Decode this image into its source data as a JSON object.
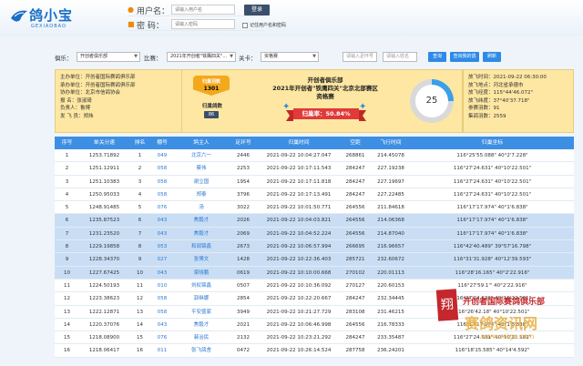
{
  "brand": {
    "name": "鸽小宝",
    "subtitle": "GEXIAOBAO"
  },
  "login": {
    "username_label": "用户名：",
    "username_placeholder": "请输入用户名",
    "password_label": "密  码：",
    "password_placeholder": "请输入密码",
    "login_button": "登录",
    "remember_label": "记住用户名和密码"
  },
  "filters": {
    "club_label": "俱乐：",
    "club_value": "开创者俱乐部",
    "race_label": "比赛：",
    "race_value": "2021年开创者\"铁鹰四关\"...",
    "level_label": "关卡：",
    "level_value": "资格赛",
    "ring_placeholder": "请输入足环号",
    "name_placeholder": "请输入姓名",
    "search_button": "查询",
    "my_pigeon_button": "查询我的鸽",
    "refresh_button": "刷新"
  },
  "club_info": [
    "主办单位：开创者国际赛鸽俱乐部",
    "承办单位：开创者国际赛鸽俱乐部",
    "协办单位：北京市信鸽协会",
    "报  名：张淑琦",
    "负责人：鲁博",
    "发 飞 员：郑炜"
  ],
  "stats": {
    "returned_label": "归巢羽数",
    "returned_value": "1301",
    "feathers_label": "归巢鸽数",
    "feathers_value": "86"
  },
  "race": {
    "club": "开创者俱乐部",
    "title": "2021年开创者\"铁鹰四关\"北京北部赛区",
    "stage": "资格赛",
    "rate_label": "归巢率：",
    "rate_value": "50.84%"
  },
  "gauge": {
    "value": "25",
    "fraction": 0.25
  },
  "release_info": [
    "放飞时间：2021-09-22 06:30:00",
    "放飞地点：河北省承德市",
    "放飞经度：115°44'46.072\"",
    "放飞纬度：37°40'37.718\"",
    "参赛羽数：91",
    "集鸽羽数：2559"
  ],
  "table": {
    "headers": [
      "序号",
      "单关分速",
      "排名",
      "棚号",
      "鸽主人",
      "足环号",
      "归巢时间",
      "空距",
      "飞行时间",
      "归巢坐标"
    ],
    "rows": [
      [
        "1",
        "1253.71892",
        "1",
        "049",
        "北京六一",
        "2446",
        "2021-09-22 10:04:27.047",
        "268861",
        "214.45078",
        "116°25'55.088\" 40°2'7.228\""
      ],
      [
        "2",
        "1251.12911",
        "2",
        "058",
        "蔡伟",
        "2253",
        "2021-09-22 10:17:11.543",
        "284247",
        "227.19238",
        "116°27'24.631\" 40°10'22.501\""
      ],
      [
        "3",
        "1251.10383",
        "3",
        "058",
        "谢立国",
        "1954",
        "2021-09-22 10:17:11.818",
        "284247",
        "227.19697",
        "116°27'24.631\" 40°10'22.501\""
      ],
      [
        "4",
        "1250.95033",
        "4",
        "058",
        "郑泰",
        "3796",
        "2021-09-22 10:17:13.491",
        "284247",
        "227.22485",
        "116°27'24.631\" 40°10'22.501\""
      ],
      [
        "5",
        "1248.91485",
        "5",
        "076",
        "汤",
        "3022",
        "2021-09-22 10:01:50.771",
        "264556",
        "211.84618",
        "116°17'17.974\" 40°1'6.838\""
      ],
      [
        "6",
        "1235.87523",
        "6",
        "043",
        "焦毅才",
        "2026",
        "2021-09-22 10:04:03.821",
        "264556",
        "214.06368",
        "116°17'17.974\" 40°1'6.838\""
      ],
      [
        "7",
        "1231.23520",
        "7",
        "043",
        "焦毅才",
        "2069",
        "2021-09-22 10:04:52.224",
        "264556",
        "214.87040",
        "116°17'17.974\" 40°1'6.838\""
      ],
      [
        "8",
        "1229.19858",
        "8",
        "053",
        "和闻锦鑫",
        "2673",
        "2021-09-22 10:06:57.994",
        "266695",
        "216.96657",
        "116°42'40.489\" 39°57'16.798\""
      ],
      [
        "9",
        "1228.34370",
        "9",
        "027",
        "张博文",
        "1428",
        "2021-09-22 10:22:36.403",
        "285721",
        "232.60672",
        "116°31'31.928\" 40°12'39.593\""
      ],
      [
        "10",
        "1227.67425",
        "10",
        "043",
        "梁晓鹏",
        "0619",
        "2021-09-22 10:10:00.668",
        "270102",
        "220.01113",
        "116°28'16.165\" 40°2'22.916\""
      ],
      [
        "11",
        "1224.50193",
        "11",
        "010",
        "刘权锦鑫",
        "0507",
        "2021-09-22 10:10:36.092",
        "270127",
        "220.60153",
        "116°27'59.1'\" 40°2'22.916\""
      ],
      [
        "12",
        "1223.38623",
        "12",
        "058",
        "郭继娜",
        "2854",
        "2021-09-22 10:22:20.667",
        "284247",
        "232.34445",
        "116°27'24.631\" 40°10'22.501\""
      ],
      [
        "13",
        "1222.12871",
        "13",
        "058",
        "平安盛家",
        "3949",
        "2021-09-22 10:21:27.729",
        "283108",
        "231.46215",
        "116°26'42.18\" 40°10'22.501\""
      ],
      [
        "14",
        "1220.37076",
        "14",
        "043",
        "焦毅才",
        "2021",
        "2021-09-22 10:06:46.998",
        "264556",
        "216.78333",
        "116°17'17.974\" 40°1'6.838\""
      ],
      [
        "15",
        "1218.08900",
        "15",
        "076",
        "裴治民",
        "2132",
        "2021-09-22 10:23:21.292",
        "284247",
        "233.35487",
        "116°27'24.631\" 40°10'22.501\""
      ],
      [
        "16",
        "1218.06417",
        "16",
        "011",
        "张飞鸽舍",
        "0472",
        "2021-09-22 10:26:14.524",
        "287758",
        "236.24201",
        "116°18'15.585\" 40°14'4.592\""
      ]
    ]
  },
  "watermark": {
    "seal": "翔",
    "club": "开创者国际赛鸽俱乐部",
    "site": "赛鸽资讯网",
    "url": "www.saige.com"
  }
}
